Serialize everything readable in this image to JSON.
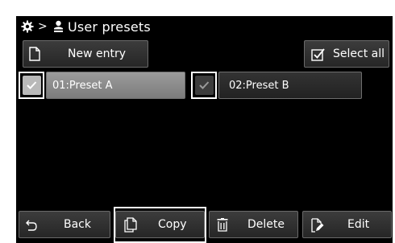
{
  "colors": {
    "screen_bg": "#000000",
    "button_bg": "#2f2f2f",
    "preset_selected_bg": "#8a8a8a",
    "preset_normal_bg": "#2a2a2a",
    "checkbox_checked_bg": "#b9b9b9",
    "checkbox_dark_bg": "#3c3c3c",
    "highlight_border": "#ffffff"
  },
  "header": {
    "settings_icon": "gear-icon",
    "separator": ">",
    "section_icon": "user-icon",
    "title": "User presets"
  },
  "toolbar": {
    "new_entry": {
      "label": "New entry",
      "icon": "document-icon"
    },
    "select_all": {
      "label": "Select all",
      "icon": "checked-box-icon"
    }
  },
  "presets": [
    {
      "label": "01:Preset A",
      "checked": true,
      "selected": true
    },
    {
      "label": "02:Preset B",
      "checked": true,
      "selected": false
    }
  ],
  "bottom_bar": {
    "back": {
      "label": "Back",
      "icon": "back-arrow-icon"
    },
    "copy": {
      "label": "Copy",
      "icon": "copy-icon"
    },
    "delete": {
      "label": "Delete",
      "icon": "trash-icon"
    },
    "edit": {
      "label": "Edit",
      "icon": "edit-document-icon"
    }
  }
}
